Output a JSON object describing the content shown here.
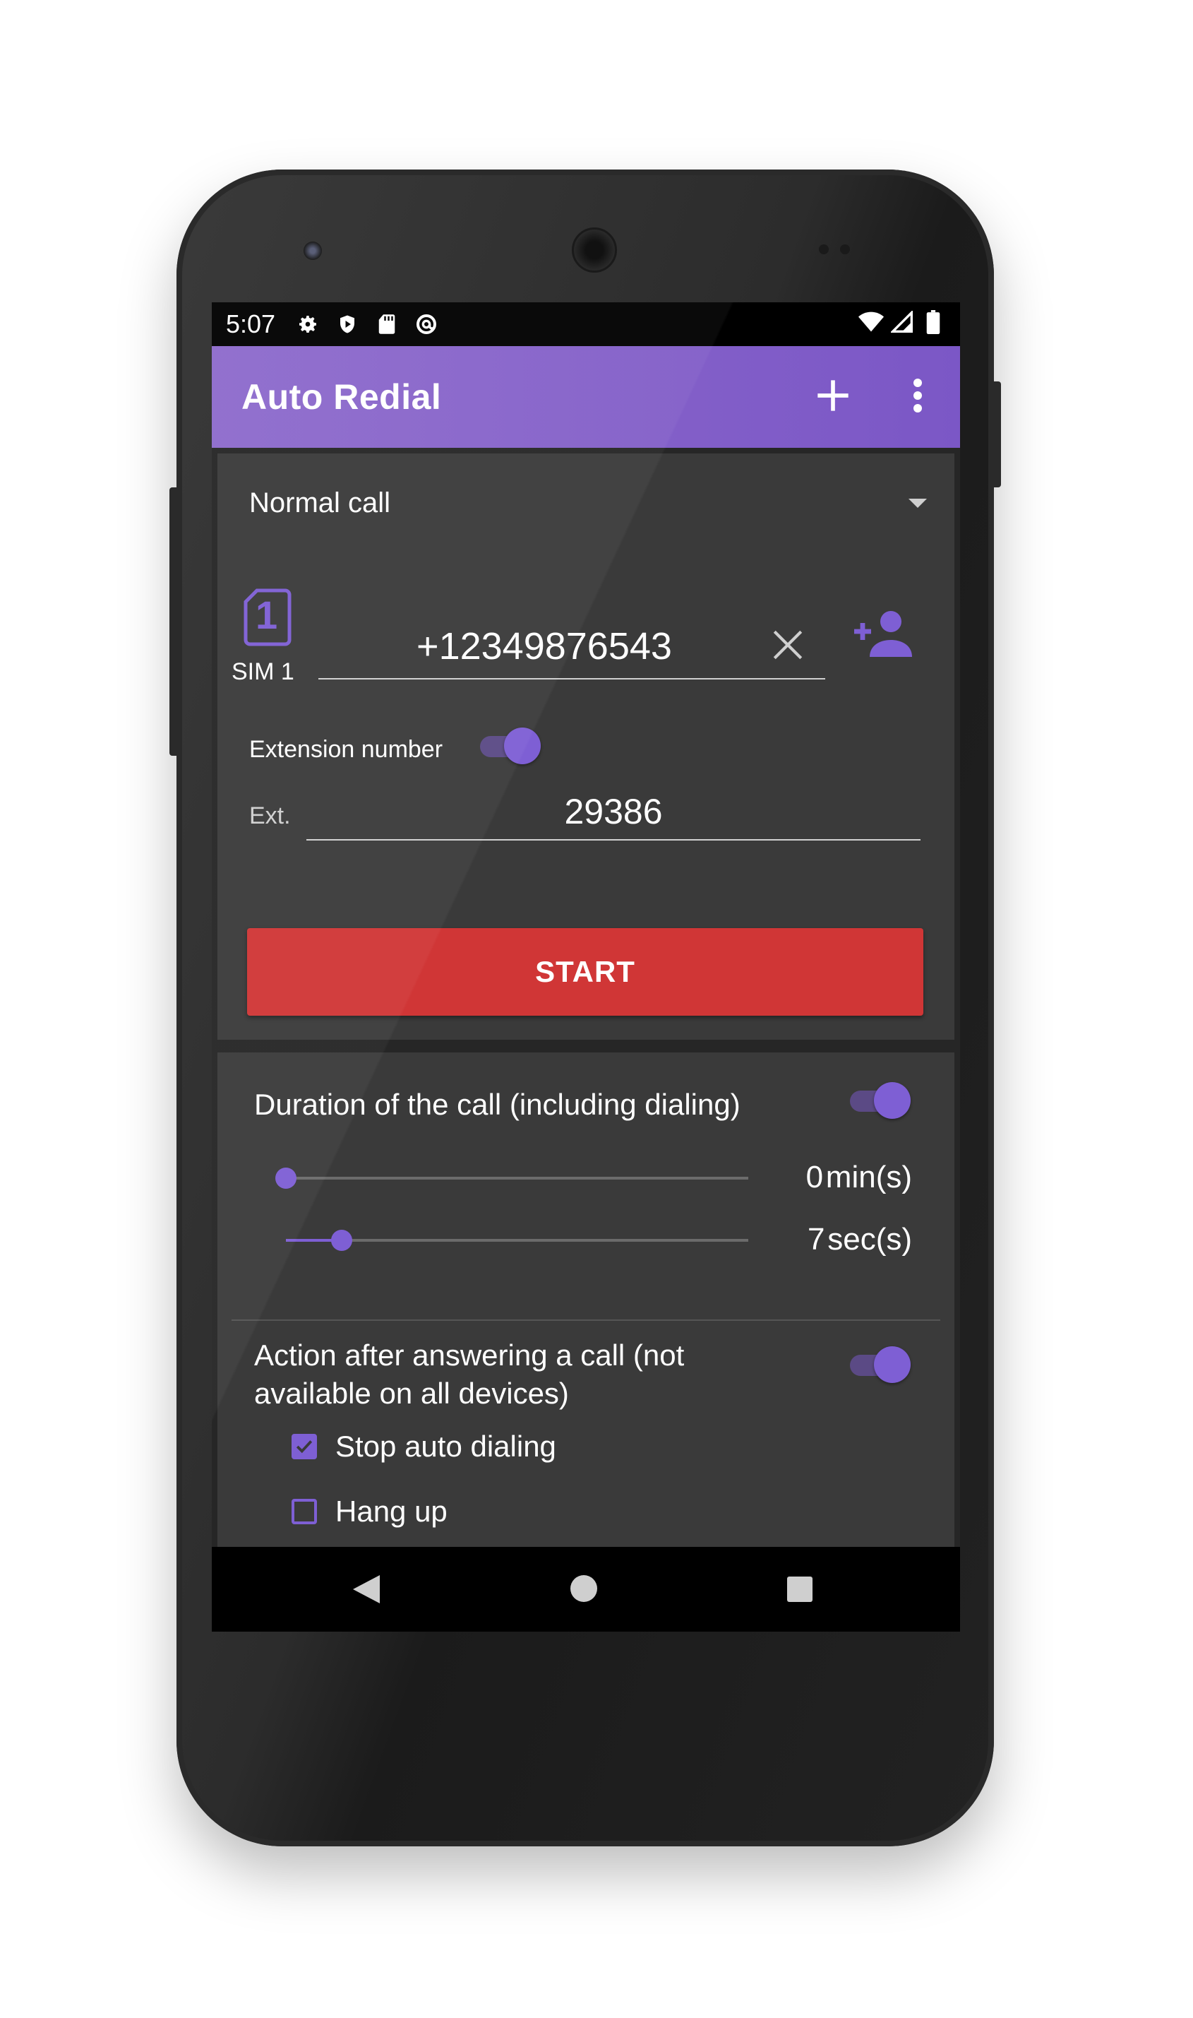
{
  "status_bar": {
    "time": "5:07",
    "left_icons": [
      "gear-icon",
      "shield-icon",
      "sd-card-icon",
      "at-sign-icon"
    ],
    "right_icons": [
      "wifi-icon",
      "signal-icon",
      "battery-icon"
    ]
  },
  "app_bar": {
    "title": "Auto Redial",
    "actions": [
      "plus-icon",
      "more-vert-icon"
    ]
  },
  "call_card": {
    "call_type": "Normal call",
    "sim": {
      "number": "1",
      "label": "SIM 1"
    },
    "phone_number": "+12349876543",
    "extension": {
      "label": "Extension number",
      "enabled": true,
      "prefix": "Ext.",
      "value": "29386"
    },
    "start_label": "START"
  },
  "settings_card": {
    "duration": {
      "title": "Duration of the call (including dialing)",
      "enabled": true,
      "minutes": {
        "value": 0,
        "display": "0",
        "unit": "min(s)",
        "fraction": 0.0
      },
      "seconds": {
        "value": 7,
        "display": "7",
        "unit": "sec(s)",
        "fraction": 0.12
      }
    },
    "action": {
      "title": "Action after answering a call (not available on all devices)",
      "enabled": true,
      "options": [
        {
          "label": "Stop auto dialing",
          "checked": true
        },
        {
          "label": "Hang up",
          "checked": false
        }
      ]
    }
  },
  "colors": {
    "accent": "#7e5fd4",
    "app_bar": "#7b57c6",
    "start_button": "#d03636",
    "card": "#3a3a3a",
    "background": "#262626"
  }
}
